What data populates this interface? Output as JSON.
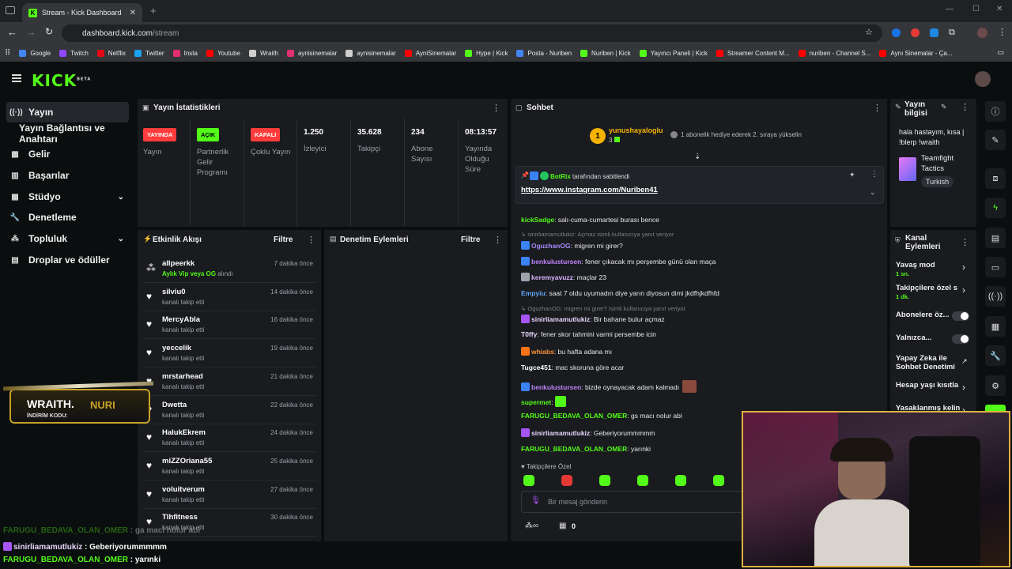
{
  "browser": {
    "tab_title": "Stream - Kick Dashboard",
    "url_host": "dashboard.kick.com",
    "url_path": "/stream",
    "bookmarks": [
      {
        "label": "Google",
        "color": "#4285f4"
      },
      {
        "label": "Twitch",
        "color": "#9146ff"
      },
      {
        "label": "Netflix",
        "color": "#e50914"
      },
      {
        "label": "Twitter",
        "color": "#1da1f2"
      },
      {
        "label": "Insta",
        "color": "#e1306c"
      },
      {
        "label": "Youtube",
        "color": "#ff0000"
      },
      {
        "label": "Wraith",
        "color": "#cfcfcf"
      },
      {
        "label": "aynisinemalar",
        "color": "#e1306c"
      },
      {
        "label": "aynisinemalar",
        "color": "#cfcfcf"
      },
      {
        "label": "AyniSinemalar",
        "color": "#ff0000"
      },
      {
        "label": "Hype | Kick",
        "color": "#53fc18"
      },
      {
        "label": "Posta - Nuriben",
        "color": "#4285f4"
      },
      {
        "label": "Nuriben | Kick",
        "color": "#53fc18"
      },
      {
        "label": "Yayıncı Paneli | Kick",
        "color": "#53fc18"
      },
      {
        "label": "Streamer Content M...",
        "color": "#ff0000"
      },
      {
        "label": "nuriben - Channel S...",
        "color": "#ff0000"
      },
      {
        "label": "Aynı Sinemalar - Ça...",
        "color": "#ff0000"
      }
    ]
  },
  "kick": {
    "logo": "KICK",
    "beta": "BETA"
  },
  "sidebar": [
    {
      "label": "Yayın",
      "icon": "broadcast-icon"
    },
    {
      "label": "Yayın Bağlantısı ve Anahtarı",
      "icon": ""
    },
    {
      "label": "Gelir",
      "icon": "money-icon"
    },
    {
      "label": "Başarılar",
      "icon": "achievement-icon"
    },
    {
      "label": "Stüdyo",
      "icon": "studio-icon"
    },
    {
      "label": "Denetleme",
      "icon": "wrench-icon"
    },
    {
      "label": "Topluluk",
      "icon": "community-icon"
    },
    {
      "label": "Droplar ve ödüller",
      "icon": "drops-icon"
    }
  ],
  "stats": {
    "title": "Yayın İstatistikleri",
    "items": [
      {
        "badge": "YAYINDA",
        "label": "Yayın",
        "badge_color": "#ff3b3b"
      },
      {
        "badge": "AÇIK",
        "label": "Partnerlik Gelir Programı",
        "badge_color": "#53fc18"
      },
      {
        "badge": "KAPALI",
        "label": "Çoklu Yayın",
        "badge_color": "#ff3b3b"
      },
      {
        "value": "1.250",
        "label": "İzleyici"
      },
      {
        "value": "35.628",
        "label": "Takipçi"
      },
      {
        "value": "234",
        "label": "Abone Sayısı"
      },
      {
        "value": "08:13:57",
        "label": "Yayında Olduğu Süre"
      }
    ]
  },
  "activity": {
    "title": "Etkinlik Akışı",
    "filter": "Filtre",
    "rows": [
      {
        "name": "allpeerkk",
        "sub": "Aylık Vip veya OG alındı",
        "sub_hl": "Aylık Vip veya OG",
        "sub_rest": " alındı",
        "time": "7 dakika önce"
      },
      {
        "name": "silviu0",
        "sub": "kanalı takip etti",
        "time": "14 dakika önce"
      },
      {
        "name": "MercyAbla",
        "sub": "kanalı takip etti",
        "time": "16 dakika önce"
      },
      {
        "name": "yeccelik",
        "sub": "kanalı takip etti",
        "time": "19 dakika önce"
      },
      {
        "name": "mrstarhead",
        "sub": "kanalı takip etti",
        "time": "21 dakika önce"
      },
      {
        "name": "Dwetta",
        "sub": "kanalı takip etti",
        "time": "22 dakika önce"
      },
      {
        "name": "HalukEkrem",
        "sub": "kanalı takip etti",
        "time": "24 dakika önce"
      },
      {
        "name": "miZZOriana55",
        "sub": "kanalı takip etti",
        "time": "25 dakika önce"
      },
      {
        "name": "voluitverum",
        "sub": "kanalı takip etti",
        "time": "27 dakika önce"
      },
      {
        "name": "Tlhfitness",
        "sub": "kanalı takip etti",
        "time": "30 dakika önce"
      }
    ]
  },
  "moderation": {
    "title": "Denetim Eylemleri",
    "filter": "Filtre"
  },
  "chat": {
    "title": "Sohbet",
    "gift_user": "yunushayaloglu",
    "gift_count": "3",
    "gift_text": "1 abonelik hediye ederek 2. sıraya yükselin",
    "pinned_by": "BotRix",
    "pinned_text": "tarafından sabitlendi",
    "pinned_link": "https://www.instagram.com/Nuriben41",
    "messages": [
      {
        "user": "kickSadge",
        "color": "#53fc18",
        "text": "salı-cuma-cumartesi burası bence"
      },
      {
        "reply": "sinirliamamutlukiz: Açmaz isimli kullanıcıya yanıt veriyor"
      },
      {
        "user": "OguzhanOG",
        "color": "#a78bfa",
        "badge": "#3b82f6",
        "text": "migren mi girer?"
      },
      {
        "user": "benkulustursen",
        "color": "#c084fc",
        "badge": "#3b82f6",
        "text": "fener çıkacak mı perşembe günü olan maça"
      },
      {
        "user": "keremyavuzz",
        "color": "#d8b4fe",
        "badge": "#9ca3af",
        "text": "maçlar 23"
      },
      {
        "user": "Empyiu",
        "color": "#60a5fa",
        "text": "saat 7 oldu uyumadın diye yarın diyosun dimi jkdfhjkdfhfd"
      },
      {
        "reply": "OguzhanOG: migren mi girer? isimli kullanıcıya yanıt veriyor"
      },
      {
        "user": "sinirliamamutlukiz",
        "color": "#e9d5ff",
        "badge": "#a855f7",
        "text": "Bir bahane bulur açmaz"
      },
      {
        "user": "T0ffy",
        "color": "#e9d5ff",
        "text": "fener skor tahmini varmi persembe icin"
      },
      {
        "user": "whiabs",
        "color": "#fb923c",
        "badge": "#f97316",
        "text": "bu hafta adana mı"
      },
      {
        "user": "Tugce451",
        "color": "#fff",
        "text": "mac skoruna göre acar"
      },
      {
        "user": "benkulustursen",
        "color": "#c084fc",
        "badge": "#3b82f6",
        "text": "bizde oynayacak adam kalmadı"
      },
      {
        "user": "supermet",
        "color": "#53fc18",
        "text": ""
      },
      {
        "user": "FARUGU_BEDAVA_OLAN_OMER",
        "color": "#53fc18",
        "text": "gs macı nolur abi"
      },
      {
        "user": "sinirliamamutlukiz",
        "color": "#e9d5ff",
        "badge": "#a855f7",
        "text": "Geberiyorummmmm"
      },
      {
        "user": "FARUGU_BEDAVA_OLAN_OMER",
        "color": "#53fc18",
        "text": "yarınki"
      }
    ],
    "followers_only": "Takipçilere Özel",
    "input_placeholder": "Bir mesaj gönderin",
    "points": "0"
  },
  "stream_info": {
    "title": "Yayın bilgisi",
    "stream_title": "hala hastayım, kısa | !blerp !wraith",
    "category": "Teamfight Tactics",
    "tag": "Turkish"
  },
  "channel_actions": {
    "title": "Kanal Eylemleri",
    "items": [
      {
        "label": "Yavaş mod",
        "sub": "1 sn.",
        "type": "arrow"
      },
      {
        "label": "Takipçilere özel s",
        "sub": "1 dk.",
        "type": "arrow"
      },
      {
        "label": "Abonelere öz...",
        "type": "toggle"
      },
      {
        "label": "Yalnızca...",
        "type": "toggle"
      },
      {
        "label": "Yapay Zeka ile Sohbet Denetimi",
        "type": "link"
      },
      {
        "label": "Hesap yaşı kısıtla",
        "type": "arrow"
      },
      {
        "label": "Yasaklanmış kelin",
        "type": "arrow"
      }
    ]
  },
  "overlay": {
    "brand": "WRAITH.",
    "code_label": "İNDİRİM KODU:",
    "code": "NURI",
    "chat_lines": [
      {
        "user": "FARUGU_BEDAVA_OLAN_OMER",
        "text": "ga maci nolur abi"
      },
      {
        "user": "sinirliamamutlukiz",
        "text": "Geberiyorummmmm"
      },
      {
        "user": "FARUGU_BEDAVA_OLAN_OMER",
        "text": "yarınki"
      }
    ]
  },
  "colors": {
    "accent": "#53fc18",
    "live": "#ff3b3b",
    "panel": "#191b1f",
    "bg": "#0b0e0f"
  }
}
